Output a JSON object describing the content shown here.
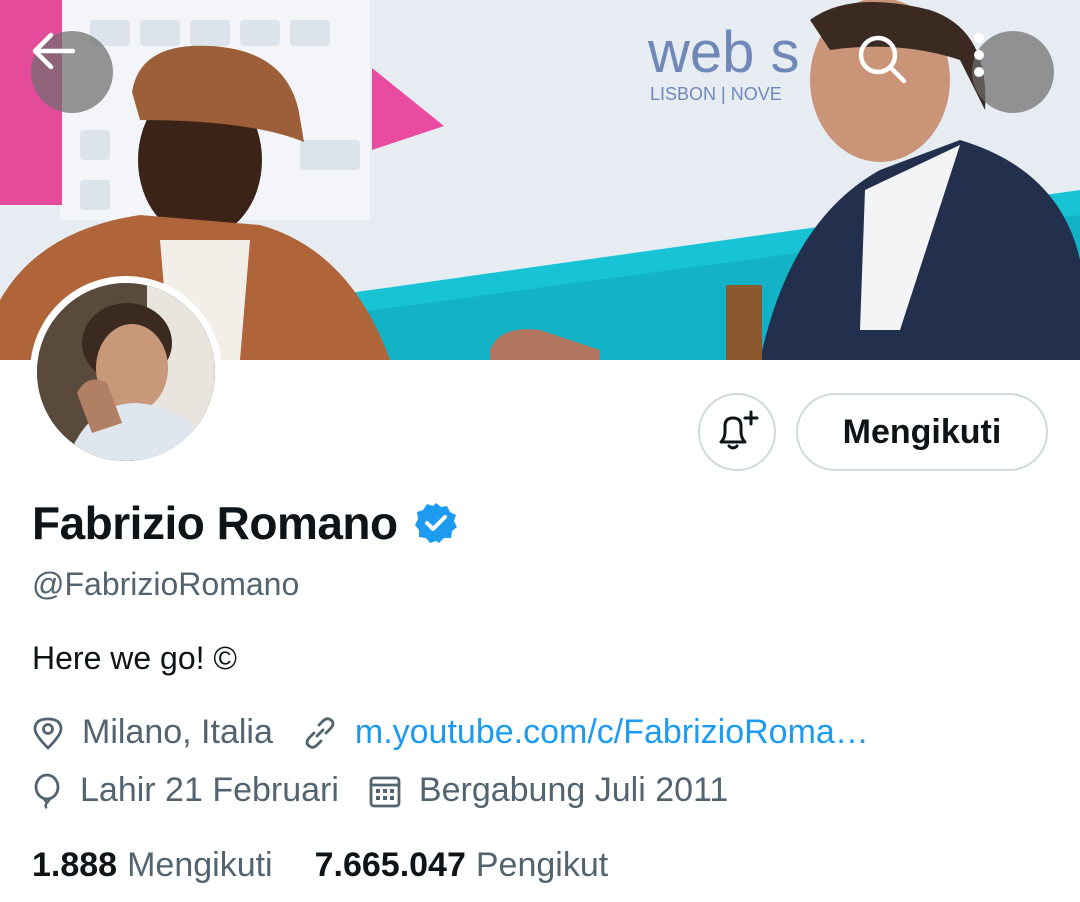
{
  "header": {
    "back_icon": "arrow-left-icon",
    "search_icon": "search-icon",
    "more_icon": "more-vertical-icon",
    "banner_text": "web s",
    "banner_subtext": "LISBON | NOVE"
  },
  "profile": {
    "name": "Fabrizio Romano",
    "handle": "@FabrizioRomano",
    "bio": "Here we go! ©",
    "location": "Milano, Italia",
    "website": "m.youtube.com/c/FabrizioRoma…",
    "birthday": "Lahir 21 Februari",
    "joined": "Bergabung Juli 2011"
  },
  "actions": {
    "notify_icon": "bell-plus-icon",
    "follow_label": "Mengikuti"
  },
  "stats": {
    "following_count": "1.888",
    "following_label": "Mengikuti",
    "followers_count": "7.665.047",
    "followers_label": "Pengikut"
  },
  "colors": {
    "accent": "#1d9bf0",
    "secondary_text": "#536471",
    "primary_text": "#0f1419",
    "border": "#cfd9de"
  }
}
